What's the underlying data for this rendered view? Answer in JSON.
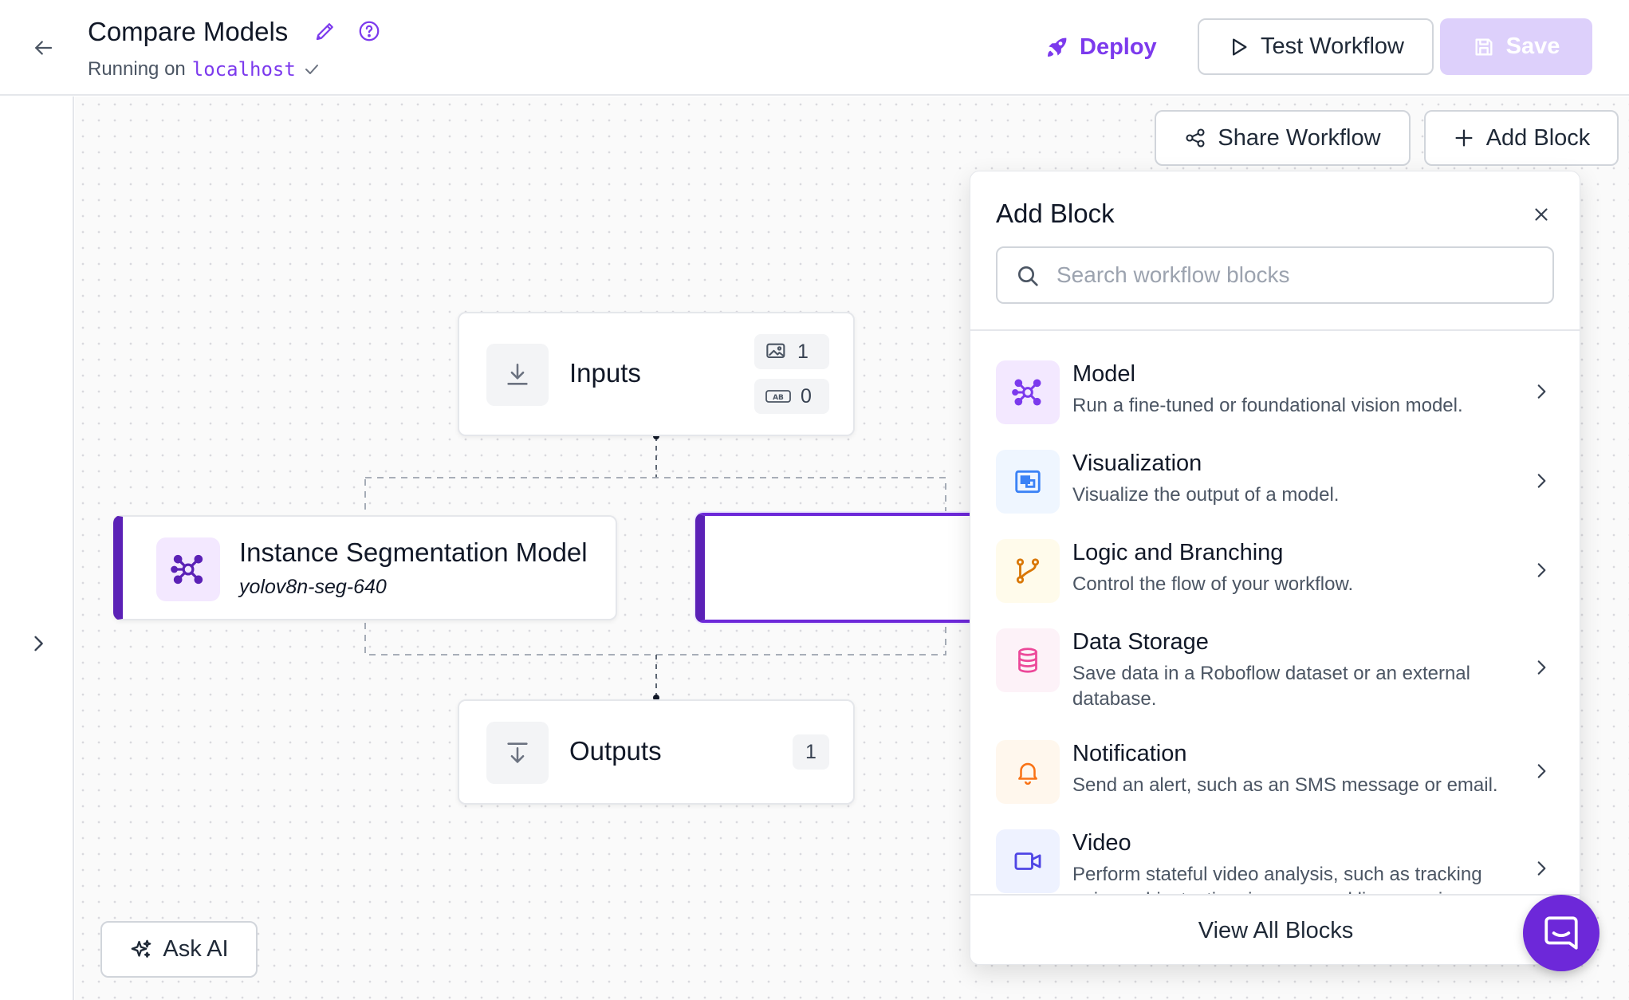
{
  "header": {
    "title": "Compare Models",
    "running_prefix": "Running on",
    "host": "localhost",
    "deploy_label": "Deploy",
    "test_label": "Test Workflow",
    "save_label": "Save"
  },
  "toolbar": {
    "share_label": "Share Workflow",
    "add_block_label": "Add Block"
  },
  "nodes": {
    "inputs": {
      "label": "Inputs",
      "image_count": "1",
      "parameter_count": "0"
    },
    "model": {
      "name": "Instance Segmentation Model",
      "model_id": "yolov8n-seg-640"
    },
    "outputs": {
      "label": "Outputs",
      "count": "1"
    }
  },
  "panel": {
    "title": "Add Block",
    "search_placeholder": "Search workflow blocks",
    "categories": [
      {
        "name": "Model",
        "description": "Run a fine-tuned or foundational vision model.",
        "icon": "model-icon",
        "color": "#7c3aed"
      },
      {
        "name": "Visualization",
        "description": "Visualize the output of a model.",
        "icon": "visualization-icon",
        "color": "#3b82f6"
      },
      {
        "name": "Logic and Branching",
        "description": "Control the flow of your workflow.",
        "icon": "branch-icon",
        "color": "#d97706"
      },
      {
        "name": "Data Storage",
        "description": "Save data in a Roboflow dataset or an external database.",
        "icon": "database-icon",
        "color": "#ec4899"
      },
      {
        "name": "Notification",
        "description": "Send an alert, such as an SMS message or email.",
        "icon": "bell-icon",
        "color": "#f97316"
      },
      {
        "name": "Video",
        "description": "Perform stateful video analysis, such as tracking unique objects, time in zone, and line crossing.",
        "icon": "video-icon",
        "color": "#4f46e5"
      }
    ],
    "view_all_label": "View All Blocks"
  },
  "ask_ai_label": "Ask AI",
  "colors": {
    "accent": "#7c3aed",
    "save_disabled": "#ddd0fb"
  }
}
